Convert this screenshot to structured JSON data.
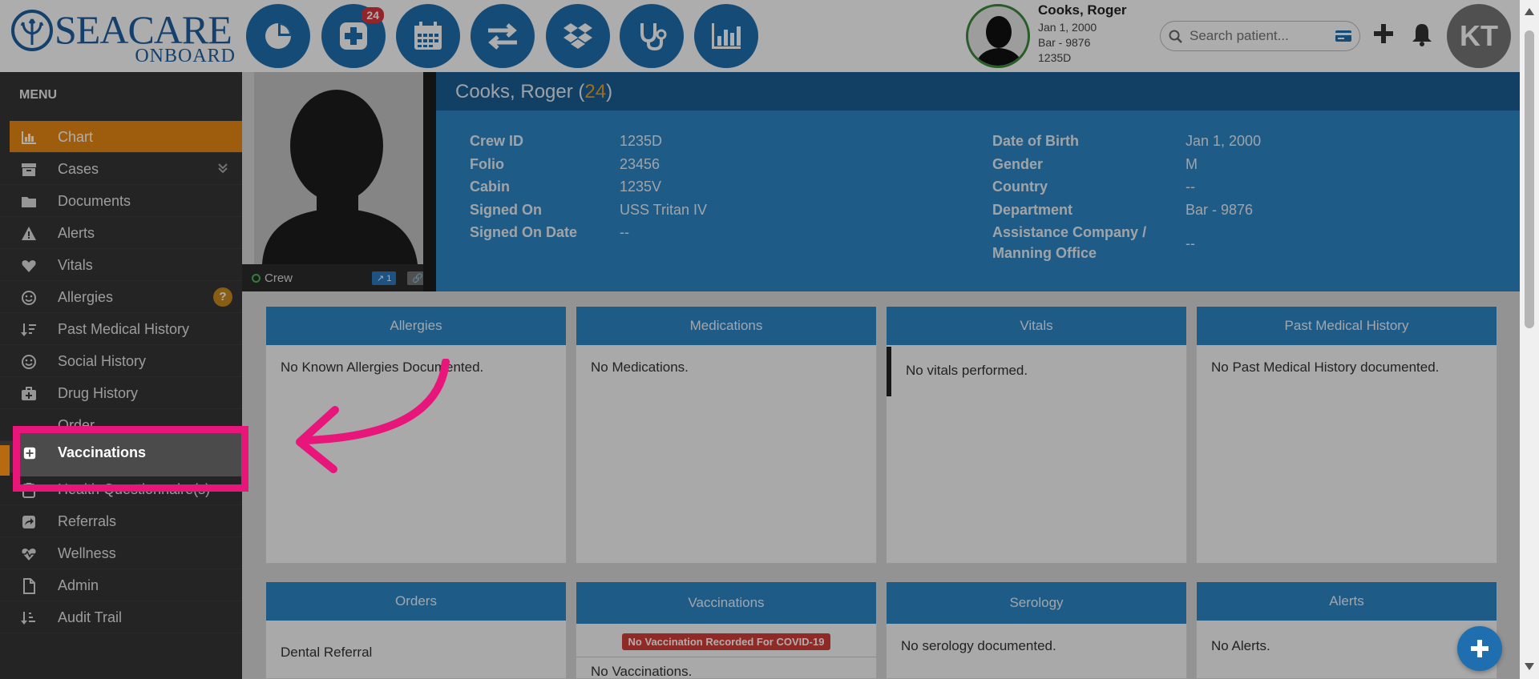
{
  "logo": {
    "brand": "SEACARE",
    "sub": "ONBOARD"
  },
  "topnav": {
    "items": [
      {
        "icon": "pie-chart-icon"
      },
      {
        "icon": "medical-plus-icon",
        "badge": "24"
      },
      {
        "icon": "calendar-icon"
      },
      {
        "icon": "transfer-arrows-icon"
      },
      {
        "icon": "dropbox-icon"
      },
      {
        "icon": "stethoscope-icon"
      },
      {
        "icon": "bar-chart-icon"
      }
    ]
  },
  "patient_mini": {
    "name": "Cooks, Roger",
    "dob": "Jan 1, 2000",
    "department": "Bar - 9876",
    "crew_id": "1235D"
  },
  "search": {
    "placeholder": "Search patient..."
  },
  "user": {
    "initials": "KT"
  },
  "sidebar": {
    "title": "MENU",
    "items": [
      {
        "label": "Chart",
        "icon": "bar-chart-icon",
        "active": true
      },
      {
        "label": "Cases",
        "icon": "archive-icon"
      },
      {
        "label": "Documents",
        "icon": "folder-icon"
      },
      {
        "label": "Alerts",
        "icon": "warning-icon"
      },
      {
        "label": "Vitals",
        "icon": "heart-icon"
      },
      {
        "label": "Allergies",
        "icon": "smile-icon",
        "badge": "?"
      },
      {
        "label": "Past Medical History",
        "icon": "sort-icon"
      },
      {
        "label": "Social History",
        "icon": "smile-icon"
      },
      {
        "label": "Drug History",
        "icon": "medkit-icon"
      },
      {
        "label": "Order",
        "icon": "order-icon"
      },
      {
        "label": "Vaccinations",
        "icon": "plus-square-icon",
        "highlighted": true
      },
      {
        "label": "Health Questionnaire(s)",
        "icon": "clipboard-icon"
      },
      {
        "label": "Referrals",
        "icon": "share-icon"
      },
      {
        "label": "Wellness",
        "icon": "heartbeat-icon"
      },
      {
        "label": "Admin",
        "icon": "file-icon"
      },
      {
        "label": "Audit Trail",
        "icon": "sort-amount-icon"
      }
    ]
  },
  "photo_strip": {
    "status": "Crew",
    "badge1": "1"
  },
  "patient": {
    "name": "Cooks, Roger",
    "age": "24",
    "left_fields": [
      {
        "label": "Crew ID",
        "value": "1235D"
      },
      {
        "label": "Folio",
        "value": "23456"
      },
      {
        "label": "Cabin",
        "value": "1235V"
      },
      {
        "label": "Signed On",
        "value": "USS Tritan IV"
      },
      {
        "label": "Signed On Date",
        "value": "--"
      }
    ],
    "right_fields": [
      {
        "label": "Date of Birth",
        "value": "Jan 1, 2000"
      },
      {
        "label": "Gender",
        "value": "M"
      },
      {
        "label": "Country",
        "value": "--"
      },
      {
        "label": "Department",
        "value": "Bar - 9876"
      },
      {
        "label": "Assistance Company / Manning Office",
        "label_line1": "Assistance Company /",
        "label_line2": "Manning Office",
        "value": "--"
      }
    ]
  },
  "cards": {
    "allergies": {
      "title": "Allergies",
      "text": "No Known Allergies Documented."
    },
    "medications": {
      "title": "Medications",
      "text": "No Medications."
    },
    "vitals": {
      "title": "Vitals",
      "text": "No vitals performed."
    },
    "pmh": {
      "title": "Past Medical History",
      "text": "No Past Medical History documented."
    },
    "orders": {
      "title": "Orders",
      "text": "Dental Referral"
    },
    "vaccinations": {
      "title": "Vaccinations",
      "alert": "No Vaccination Recorded For COVID-19",
      "text": "No Vaccinations."
    },
    "serology": {
      "title": "Serology",
      "text": "No serology documented."
    },
    "alerts": {
      "title": "Alerts",
      "text": "No Alerts."
    }
  },
  "colors": {
    "primary": "#2f86c7",
    "header_dark": "#1b5f96",
    "accent_orange": "#e88a14",
    "highlight_pink": "#e8167a",
    "sidebar_bg": "#353535"
  }
}
